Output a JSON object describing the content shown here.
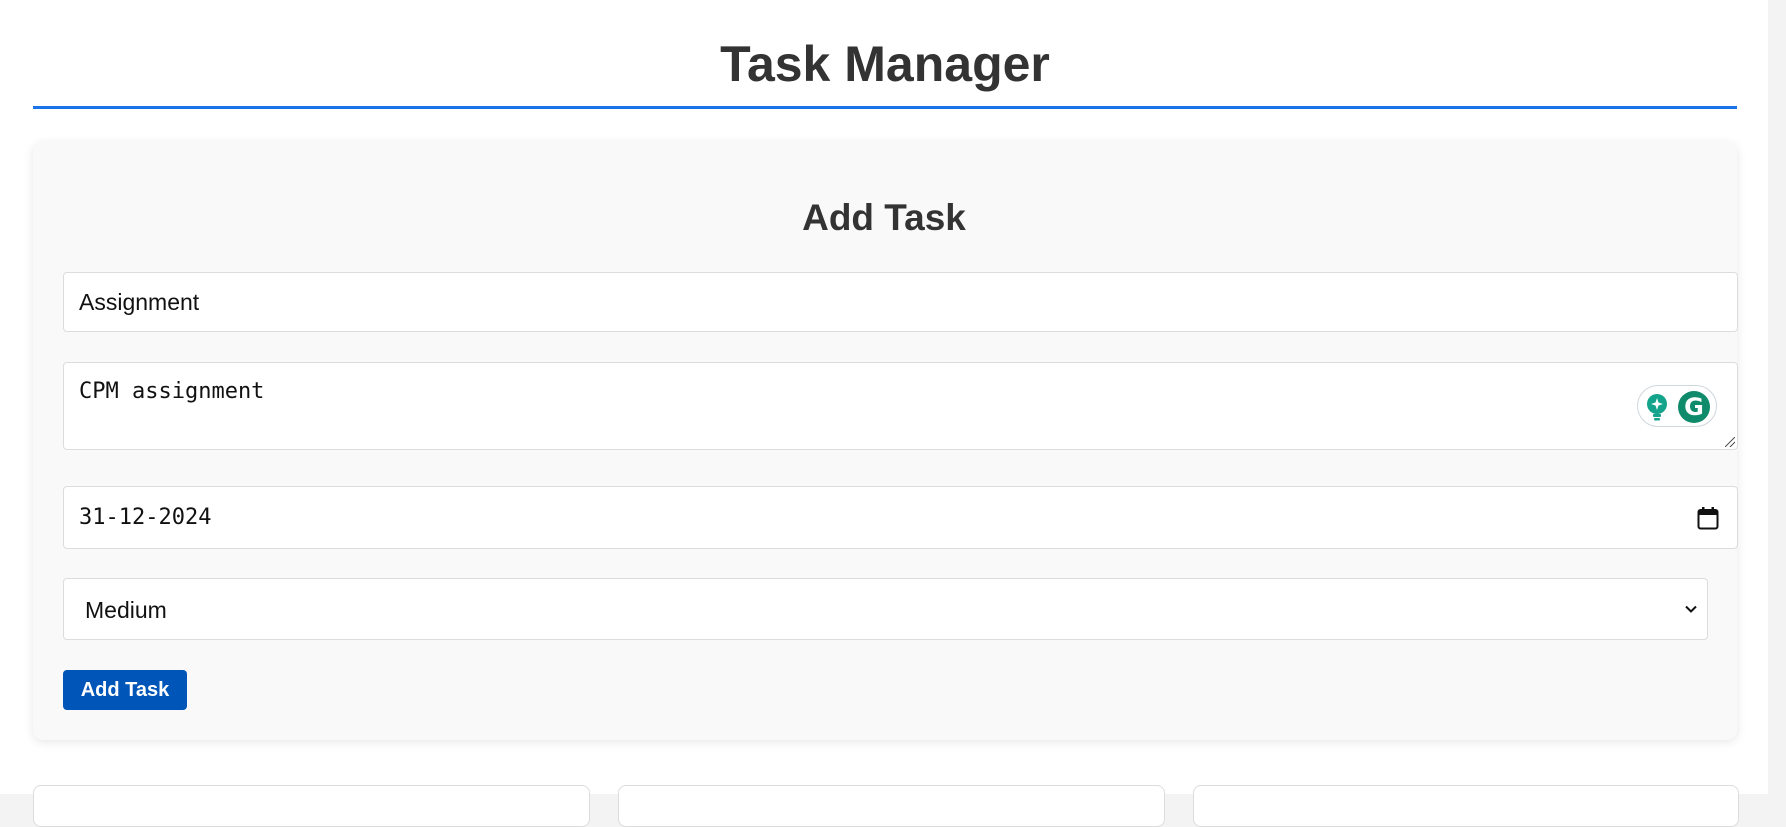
{
  "app": {
    "title": "Task Manager"
  },
  "form": {
    "heading": "Add Task",
    "title_value": "Assignment",
    "description_value": "CPM assignment",
    "due_date_value": "31-12-2024",
    "priority_selected": "Medium",
    "submit_label": "Add Task"
  },
  "icons": {
    "calendar": "calendar-icon",
    "dropdown": "chevron-down-icon",
    "grammarly": "grammarly-icon",
    "assist": "lightbulb-icon"
  },
  "colors": {
    "accent": "#1a73e8",
    "button": "#0055b8",
    "grammarly": "#0f8a6a"
  }
}
